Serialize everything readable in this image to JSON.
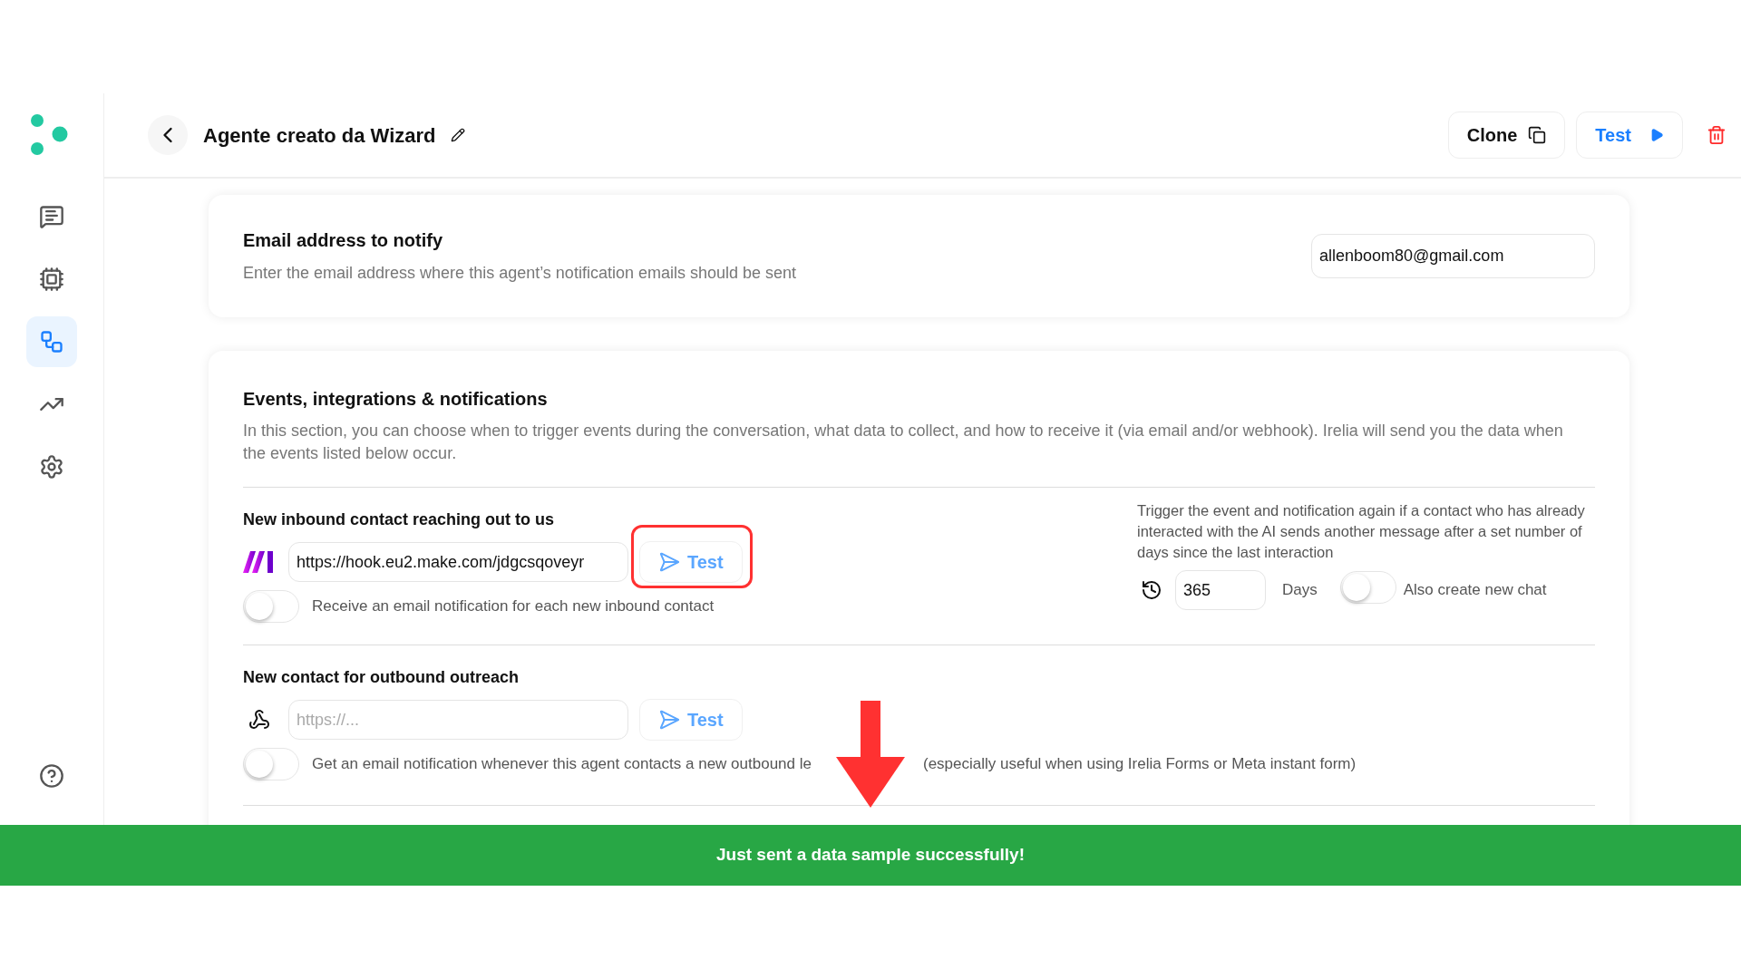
{
  "sidebar": {
    "items": [
      {
        "kind": "chat",
        "selected": false
      },
      {
        "kind": "chip",
        "selected": false
      },
      {
        "kind": "flow",
        "selected": true
      },
      {
        "kind": "chart",
        "selected": false
      },
      {
        "kind": "settings",
        "selected": false
      }
    ]
  },
  "header": {
    "title": "Agente creato da Wizard",
    "buttons": [
      {
        "label": "Clone",
        "kind": "clone"
      },
      {
        "label": "Test",
        "kind": "test"
      }
    ]
  },
  "email_card": {
    "title": "Email address to notify",
    "description": "Enter the email address where this agent’s notification emails should be sent",
    "value": "allenboom80@gmail.com"
  },
  "events_card": {
    "title": "Events, integrations & notifications",
    "description": "In this section, you can choose when to trigger events during the conversation, what data to collect, and how to receive it (via email and/or webhook). Irelia will send you the data when the events listed below occur.",
    "sections": [
      {
        "title": "New inbound contact reaching out to us",
        "kind": "make",
        "value": "https://hook.eu2.make.com/jdgcsqoveyr",
        "test_label": "Test",
        "highlighted": true,
        "toggle": {
          "on": false,
          "label": "Receive an email notification for each new inbound contact"
        },
        "retrigger": {
          "text": "Trigger the event and notification again if a contact who has already interacted with the AI sends another message after a set number of days since the last interaction",
          "days": "365",
          "unit": "Days",
          "toggle": {
            "on": false,
            "label": "Also create new chat"
          }
        }
      },
      {
        "title": "New contact for outbound outreach",
        "kind": "webhook",
        "placeholder": "https://...",
        "test_label": "Test",
        "highlighted": false,
        "toggle": {
          "on": false,
          "label": "Get an email notification whenever this agent contacts a new outbound le",
          "label_after": "(especially useful when using Irelia Forms or Meta instant form)"
        }
      }
    ]
  },
  "toast": {
    "message": "Just sent a data sample successfully!"
  }
}
